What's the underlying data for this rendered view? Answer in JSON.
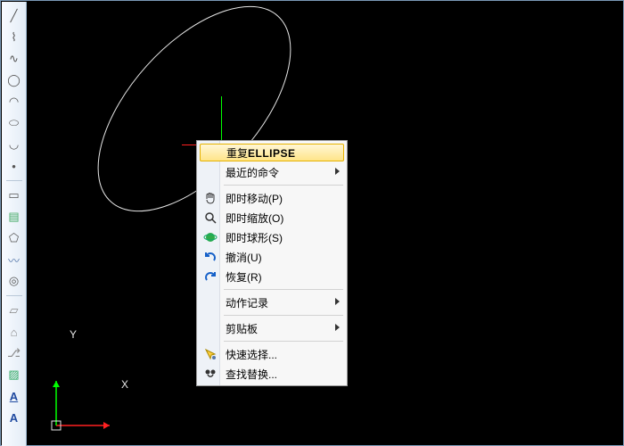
{
  "toolbar": {
    "items": [
      {
        "name": "line-tool",
        "glyph": "╱",
        "color": "#555"
      },
      {
        "name": "polyline-tool",
        "glyph": "⌇",
        "color": "#555"
      },
      {
        "name": "spline-tool",
        "glyph": "∿",
        "color": "#555"
      },
      {
        "name": "circle-tool",
        "glyph": "◯",
        "color": "#555"
      },
      {
        "name": "arc-tool",
        "glyph": "◠",
        "color": "#555"
      },
      {
        "name": "ellipse-tool",
        "glyph": "⬭",
        "color": "#555"
      },
      {
        "name": "ellipse-arc-tool",
        "glyph": "◡",
        "color": "#555"
      },
      {
        "name": "point-tool",
        "glyph": "•",
        "color": "#555"
      },
      {
        "name": "rectangle-tool",
        "glyph": "▭",
        "color": "#555"
      },
      {
        "name": "hatch-tool",
        "glyph": "▤",
        "color": "#4a6"
      },
      {
        "name": "polygon-tool",
        "glyph": "⬠",
        "color": "#555"
      },
      {
        "name": "revision-cloud-tool",
        "glyph": "〰",
        "color": "#57a"
      },
      {
        "name": "donut-tool",
        "glyph": "◎",
        "color": "#555"
      },
      {
        "name": "region-tool",
        "glyph": "▱",
        "color": "#888"
      },
      {
        "name": "wipeout-tool",
        "glyph": "⌂",
        "color": "#888"
      },
      {
        "name": "3dpolyline-tool",
        "glyph": "⎇",
        "color": "#888"
      },
      {
        "name": "gradient-tool",
        "glyph": "▨",
        "color": "#3a6"
      },
      {
        "name": "multiline-text-tool",
        "glyph": "A",
        "color": "#204aa0",
        "bold": true,
        "under": true
      },
      {
        "name": "single-text-tool",
        "glyph": "A",
        "color": "#204aa0",
        "bold": true
      }
    ]
  },
  "ucs": {
    "x": "X",
    "y": "Y"
  },
  "menu": {
    "items": [
      {
        "key": "repeat",
        "label": "重复ELLIPSE",
        "icon": "",
        "highlight": true
      },
      {
        "key": "recent",
        "label": "最近的命令",
        "icon": "",
        "submenu": true
      },
      {
        "sep": true
      },
      {
        "key": "pan",
        "label": "即时移动(P)",
        "icon": "hand"
      },
      {
        "key": "zoom",
        "label": "即时缩放(O)",
        "icon": "zoom"
      },
      {
        "key": "orbit",
        "label": "即时球形(S)",
        "icon": "orbit"
      },
      {
        "key": "undo",
        "label": "撤消(U)",
        "icon": "undo"
      },
      {
        "key": "redo",
        "label": "恢复(R)",
        "icon": "redo"
      },
      {
        "sep": true
      },
      {
        "key": "action",
        "label": "动作记录",
        "icon": "",
        "submenu": true
      },
      {
        "sep": true
      },
      {
        "key": "clip",
        "label": "剪贴板",
        "icon": "",
        "submenu": true
      },
      {
        "sep": true
      },
      {
        "key": "qselect",
        "label": "快速选择...",
        "icon": "qsel"
      },
      {
        "key": "find",
        "label": "查找替换...",
        "icon": "find"
      }
    ]
  }
}
